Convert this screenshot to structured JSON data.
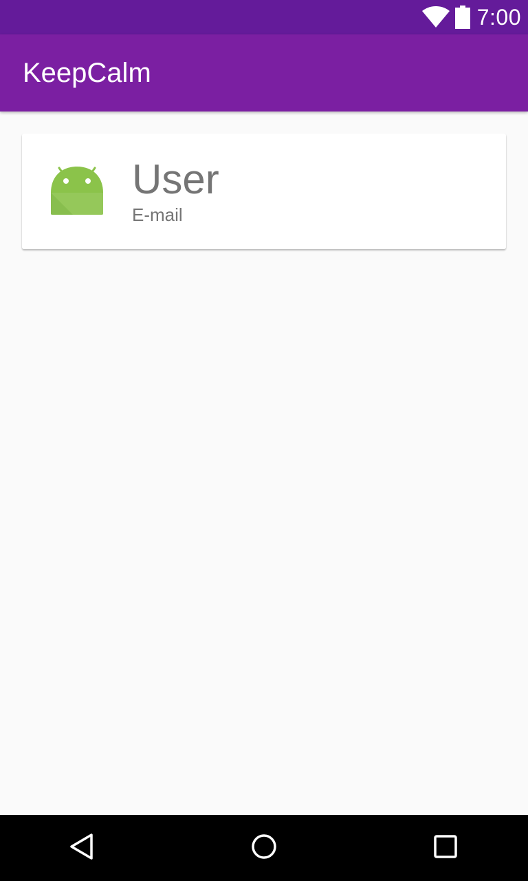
{
  "status_bar": {
    "time": "7:00",
    "icons": [
      "wifi-icon",
      "battery-icon"
    ]
  },
  "app_bar": {
    "title": "KeepCalm"
  },
  "user_card": {
    "avatar_icon": "android-icon",
    "name": "User",
    "email": "E-mail"
  },
  "nav_bar": {
    "buttons": [
      "back-icon",
      "home-icon",
      "recents-icon"
    ]
  },
  "colors": {
    "status_bar": "#641b9a",
    "app_bar": "#7b1fa2",
    "background": "#fafafa",
    "card": "#ffffff",
    "text_secondary": "#757575",
    "android_green": "#8bc34a",
    "nav_bar": "#000000"
  }
}
